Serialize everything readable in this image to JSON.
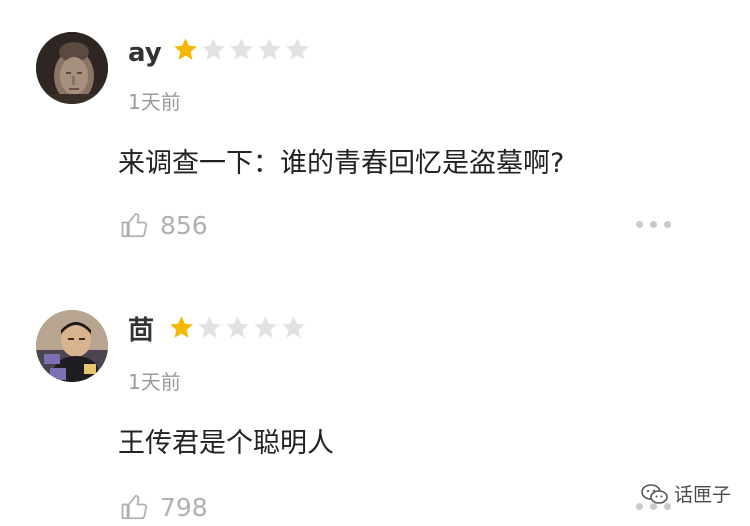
{
  "colors": {
    "star_filled": "#F5B800",
    "star_empty": "#E2E2E2",
    "meta": "#9A9A9A"
  },
  "comments": [
    {
      "username": "ay",
      "rating": 1,
      "max_rating": 5,
      "time": "1天前",
      "text": "来调查一下：谁的青春回忆是盗墓啊?",
      "likes": "856",
      "avatar_icon": "buddha-statue-avatar"
    },
    {
      "username": "茴",
      "rating": 1,
      "max_rating": 5,
      "time": "1天前",
      "text": "王传君是个聪明人",
      "likes": "798",
      "avatar_icon": "person-photo-avatar"
    }
  ],
  "watermark": {
    "text": "话匣子",
    "icon": "wechat-icon"
  }
}
